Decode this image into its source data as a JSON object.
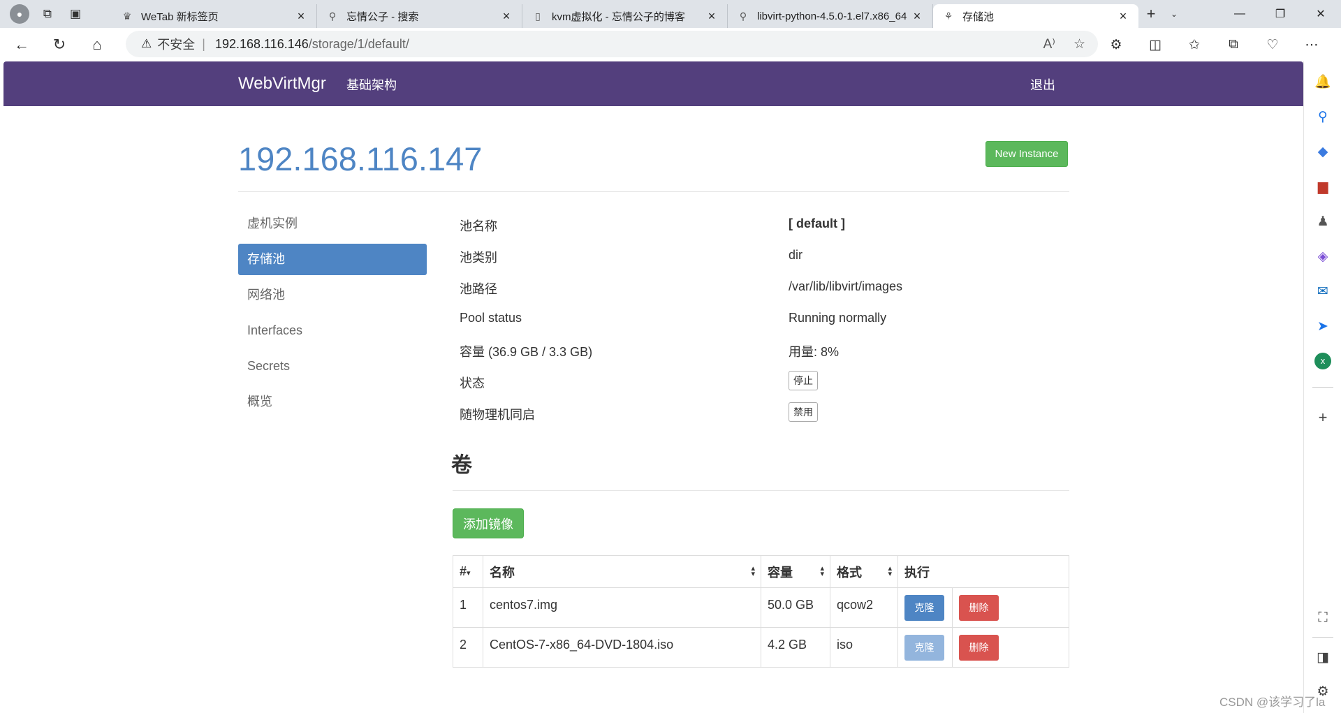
{
  "browser": {
    "tabs": [
      {
        "title": "WeTab 新标签页",
        "favicon": "wetab-icon",
        "active": false
      },
      {
        "title": "忘情公子 - 搜索",
        "favicon": "search-icon",
        "active": false
      },
      {
        "title": "kvm虚拟化 - 忘情公子的博客",
        "favicon": "page-icon",
        "active": false
      },
      {
        "title": "libvirt-python-4.5.0-1.el7.x86_64",
        "favicon": "search-icon",
        "active": false
      },
      {
        "title": "存储池",
        "favicon": "webvirt-icon",
        "active": true
      }
    ],
    "security_label": "不安全",
    "url_host": "192.168.116.146",
    "url_path": "/storage/1/default/"
  },
  "navbar": {
    "brand": "WebVirtMgr",
    "link": "基础架构",
    "logout": "退出"
  },
  "header": {
    "title": "192.168.116.147",
    "new_instance": "New Instance"
  },
  "sidenav": [
    {
      "label": "虚机实例",
      "active": false
    },
    {
      "label": "存储池",
      "active": true
    },
    {
      "label": "网络池",
      "active": false
    },
    {
      "label": "Interfaces",
      "active": false
    },
    {
      "label": "Secrets",
      "active": false
    },
    {
      "label": "概览",
      "active": false
    }
  ],
  "pool": {
    "name_label": "池名称",
    "name_value": "[ default ]",
    "type_label": "池类别",
    "type_value": "dir",
    "path_label": "池路径",
    "path_value": "/var/lib/libvirt/images",
    "status_label": "Pool status",
    "status_value": "Running normally",
    "capacity_label": "容量 (36.9 GB / 3.3 GB)",
    "usage_value": "用量: 8%",
    "state_label": "状态",
    "state_button": "停止",
    "autostart_label": "随物理机同启",
    "autostart_button": "禁用"
  },
  "volumes": {
    "title": "卷",
    "add_button": "添加镜像",
    "columns": [
      "#",
      "名称",
      "容量",
      "格式",
      "执行"
    ],
    "rows": [
      {
        "num": "1",
        "name": "centos7.img",
        "size": "50.0 GB",
        "format": "qcow2",
        "clone": "克隆",
        "delete": "删除"
      },
      {
        "num": "2",
        "name": "CentOS-7-x86_64-DVD-1804.iso",
        "size": "4.2 GB",
        "format": "iso",
        "clone": "克隆",
        "delete": "删除"
      }
    ]
  },
  "watermark": "CSDN @该学习了la",
  "colors": {
    "navbar": "#533f7d",
    "accent": "#4e85c4",
    "success": "#5cb85c",
    "danger": "#d9534f"
  }
}
